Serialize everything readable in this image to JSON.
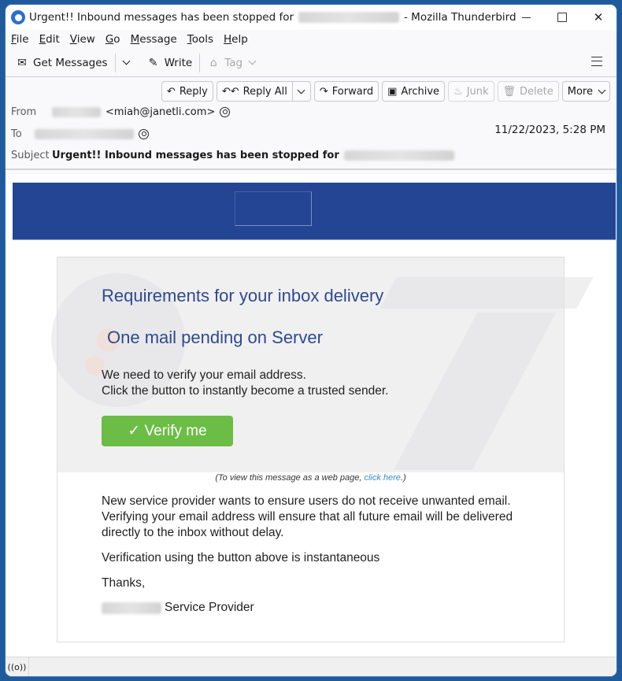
{
  "window": {
    "title_prefix": "Urgent!! Inbound messages has been stopped for",
    "title_suffix": "- Mozilla Thunderbird",
    "controls": {
      "minimize": "minimize",
      "maximize": "maximize",
      "close": "✕"
    }
  },
  "menubar": {
    "items": [
      {
        "label_ul": "F",
        "label_rest": "ile"
      },
      {
        "label_ul": "E",
        "label_rest": "dit"
      },
      {
        "label_ul": "V",
        "label_rest": "iew"
      },
      {
        "label_ul": "G",
        "label_rest": "o"
      },
      {
        "label_ul": "M",
        "label_rest": "essage"
      },
      {
        "label_ul": "T",
        "label_rest": "ools"
      },
      {
        "label_ul": "H",
        "label_rest": "elp"
      }
    ]
  },
  "toolbar": {
    "get_messages": {
      "label": "Get Messages",
      "icon": "✉"
    },
    "write": {
      "label": "Write",
      "icon": "✎"
    },
    "tag": {
      "label": "Tag",
      "icon": "⌂"
    }
  },
  "actions": {
    "reply": {
      "label": "Reply",
      "icon": "↶"
    },
    "reply_all": {
      "label": "Reply All",
      "icon": "↶↶"
    },
    "forward": {
      "label": "Forward",
      "icon": "↷"
    },
    "archive": {
      "label": "Archive",
      "icon": "▣"
    },
    "junk": {
      "label": "Junk",
      "icon": "♨"
    },
    "delete": {
      "label": "Delete",
      "icon": "🗑"
    },
    "more": {
      "label": "More"
    }
  },
  "header": {
    "from_label": "From",
    "from_email": "<miah@janetli.com>",
    "to_label": "To",
    "subject_label": "Subject",
    "subject": "Urgent!! Inbound messages has been stopped for",
    "date": "11/22/2023, 5:28 PM"
  },
  "email": {
    "colors": {
      "banner": "#234593",
      "heading": "#2d4a8f",
      "button": "#6cbd45",
      "link": "#3a8fc7"
    },
    "heading1": "Requirements for your inbox delivery",
    "heading2": "One mail pending on Server",
    "intro_line1": "We need to verify your email address.",
    "intro_line2": "Click the button to instantly become a trusted sender.",
    "verify_button": "✓ Verify me",
    "webview_prefix": "(To view this message as a web page,",
    "webview_link": "click here",
    "webview_suffix": ".)",
    "para1_line1": "New service provider wants to ensure users do not receive unwanted email.",
    "para1_line2": "Verifying your email address will ensure that all future email  will be delivered",
    "para1_line3": "directly to the inbox without delay.",
    "para2": "Verification using the button above is instantaneous",
    "thanks": "Thanks,",
    "signature": "Service Provider"
  },
  "statusbar": {
    "icon": "((o))"
  }
}
